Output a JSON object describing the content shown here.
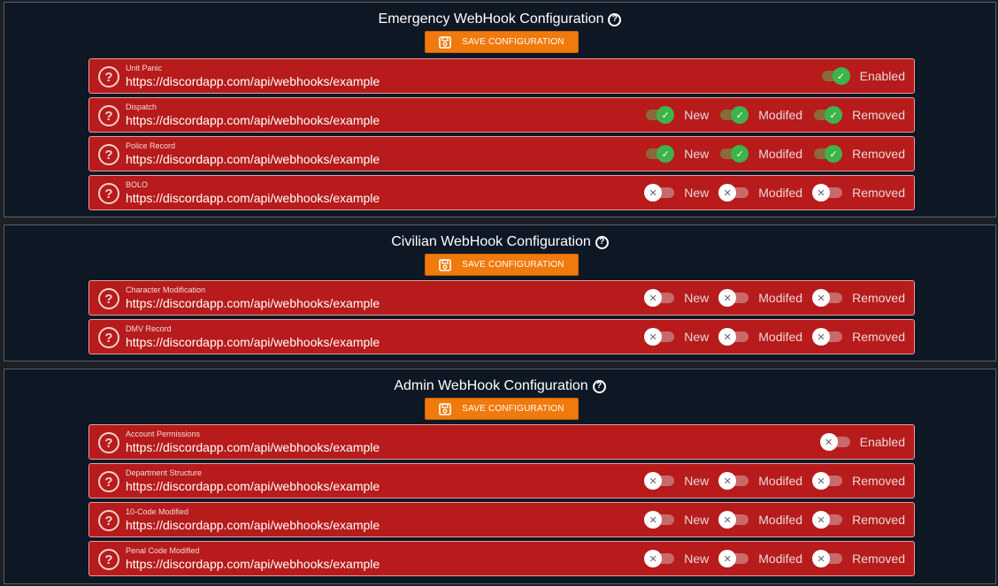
{
  "colors": {
    "panel_bg": "#0e1724",
    "row_bg": "#b71b1b",
    "save_button": "#f07a0c",
    "toggle_on": "#3db34a"
  },
  "icons": {
    "help": "question-circle-icon",
    "save": "floppy-disk-icon",
    "check": "check-icon",
    "cross": "x-icon"
  },
  "sections": [
    {
      "title": "Emergency WebHook Configuration",
      "save_label": "SAVE CONFIGURATION",
      "rows": [
        {
          "label": "Unit Panic",
          "url": "https://discordapp.com/api/webhooks/example",
          "toggles": [
            {
              "label": "Enabled",
              "on": true
            }
          ]
        },
        {
          "label": "Dispatch",
          "url": "https://discordapp.com/api/webhooks/example",
          "toggles": [
            {
              "label": "New",
              "on": true
            },
            {
              "label": "Modifed",
              "on": true
            },
            {
              "label": "Removed",
              "on": true
            }
          ]
        },
        {
          "label": "Police Record",
          "url": "https://discordapp.com/api/webhooks/example",
          "toggles": [
            {
              "label": "New",
              "on": true
            },
            {
              "label": "Modifed",
              "on": true
            },
            {
              "label": "Removed",
              "on": true
            }
          ]
        },
        {
          "label": "BOLO",
          "url": "https://discordapp.com/api/webhooks/example",
          "toggles": [
            {
              "label": "New",
              "on": false
            },
            {
              "label": "Modifed",
              "on": false
            },
            {
              "label": "Removed",
              "on": false
            }
          ]
        }
      ]
    },
    {
      "title": "Civilian WebHook Configuration",
      "save_label": "SAVE CONFIGURATION",
      "rows": [
        {
          "label": "Character Modification",
          "url": "https://discordapp.com/api/webhooks/example",
          "toggles": [
            {
              "label": "New",
              "on": false
            },
            {
              "label": "Modifed",
              "on": false
            },
            {
              "label": "Removed",
              "on": false
            }
          ]
        },
        {
          "label": "DMV Record",
          "url": "https://discordapp.com/api/webhooks/example",
          "toggles": [
            {
              "label": "New",
              "on": false
            },
            {
              "label": "Modifed",
              "on": false
            },
            {
              "label": "Removed",
              "on": false
            }
          ]
        }
      ]
    },
    {
      "title": "Admin WebHook Configuration",
      "save_label": "SAVE CONFIGURATION",
      "rows": [
        {
          "label": "Account Permissions",
          "url": "https://discordapp.com/api/webhooks/example",
          "toggles": [
            {
              "label": "Enabled",
              "on": false
            }
          ]
        },
        {
          "label": "Department Structure",
          "url": "https://discordapp.com/api/webhooks/example",
          "toggles": [
            {
              "label": "New",
              "on": false
            },
            {
              "label": "Modifed",
              "on": false
            },
            {
              "label": "Removed",
              "on": false
            }
          ]
        },
        {
          "label": "10-Code Modified",
          "url": "https://discordapp.com/api/webhooks/example",
          "toggles": [
            {
              "label": "New",
              "on": false
            },
            {
              "label": "Modifed",
              "on": false
            },
            {
              "label": "Removed",
              "on": false
            }
          ]
        },
        {
          "label": "Penal Code Modified",
          "url": "https://discordapp.com/api/webhooks/example",
          "toggles": [
            {
              "label": "New",
              "on": false
            },
            {
              "label": "Modifed",
              "on": false
            },
            {
              "label": "Removed",
              "on": false
            }
          ]
        }
      ]
    }
  ]
}
